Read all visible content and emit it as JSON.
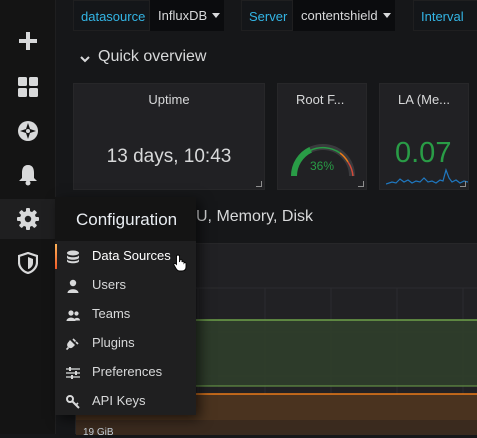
{
  "variables": [
    {
      "label": "datasource",
      "value": "InfluxDB"
    },
    {
      "label": "Server",
      "value": "contentshield"
    },
    {
      "label": "Interval"
    }
  ],
  "row": {
    "title": "Quick overview",
    "partial_row_title": "U, Memory, Disk"
  },
  "panels": {
    "uptime": {
      "title": "Uptime",
      "value": "13 days, 10:43"
    },
    "rootfs": {
      "title": "Root F...",
      "gauge_value": "36%",
      "fraction": 0.36,
      "color": "#299c46"
    },
    "la": {
      "title": "LA (Me...",
      "value": "0.07",
      "color": "#299c46"
    }
  },
  "graph": {
    "y_tick": "19 GiB"
  },
  "sidebar": {
    "items": [
      {
        "icon": "plus-icon"
      },
      {
        "icon": "dashboards-icon"
      },
      {
        "icon": "compass-icon"
      },
      {
        "icon": "bell-icon"
      },
      {
        "icon": "gear-icon"
      },
      {
        "icon": "shield-icon"
      }
    ]
  },
  "menu": {
    "title": "Configuration",
    "items": [
      {
        "label": "Data Sources",
        "icon": "database-icon"
      },
      {
        "label": "Users",
        "icon": "user-icon"
      },
      {
        "label": "Teams",
        "icon": "users-icon"
      },
      {
        "label": "Plugins",
        "icon": "plug-icon"
      },
      {
        "label": "Preferences",
        "icon": "sliders-icon"
      },
      {
        "label": "API Keys",
        "icon": "key-icon"
      }
    ]
  },
  "colors": {
    "accent": "#33b5e5",
    "green": "#299c46",
    "orange": "#eb7b18",
    "active_gradient": [
      "#ffb357",
      "#f05a28"
    ]
  }
}
